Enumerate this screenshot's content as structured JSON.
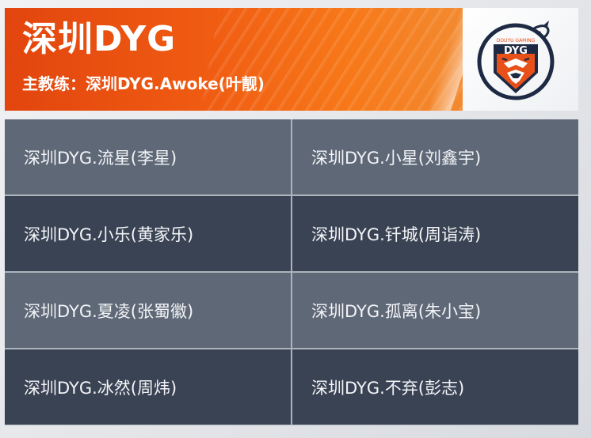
{
  "team": {
    "name": "深圳DYG",
    "coach": "主教练：深圳DYG.Awoke(叶靓)",
    "logo": {
      "text": "DYG",
      "subtext": "DOUYU GAMING",
      "icon": "tiger-shield-logo-icon",
      "colors": {
        "orange": "#e8501a",
        "navy": "#1e2a44",
        "white": "#ffffff"
      }
    }
  },
  "players": [
    "深圳DYG.流星(李星)",
    "深圳DYG.小星(刘鑫宇)",
    "深圳DYG.小乐(黄家乐)",
    "深圳DYG.钎城(周诣涛)",
    "深圳DYG.夏凌(张蜀徽)",
    "深圳DYG.孤离(朱小宝)",
    "深圳DYG.冰然(周炜)",
    "深圳DYG.不弃(彭志)"
  ],
  "colors": {
    "header_orange": "#f05c12",
    "row_light": "#5e6877",
    "row_dark": "#3a4354"
  }
}
